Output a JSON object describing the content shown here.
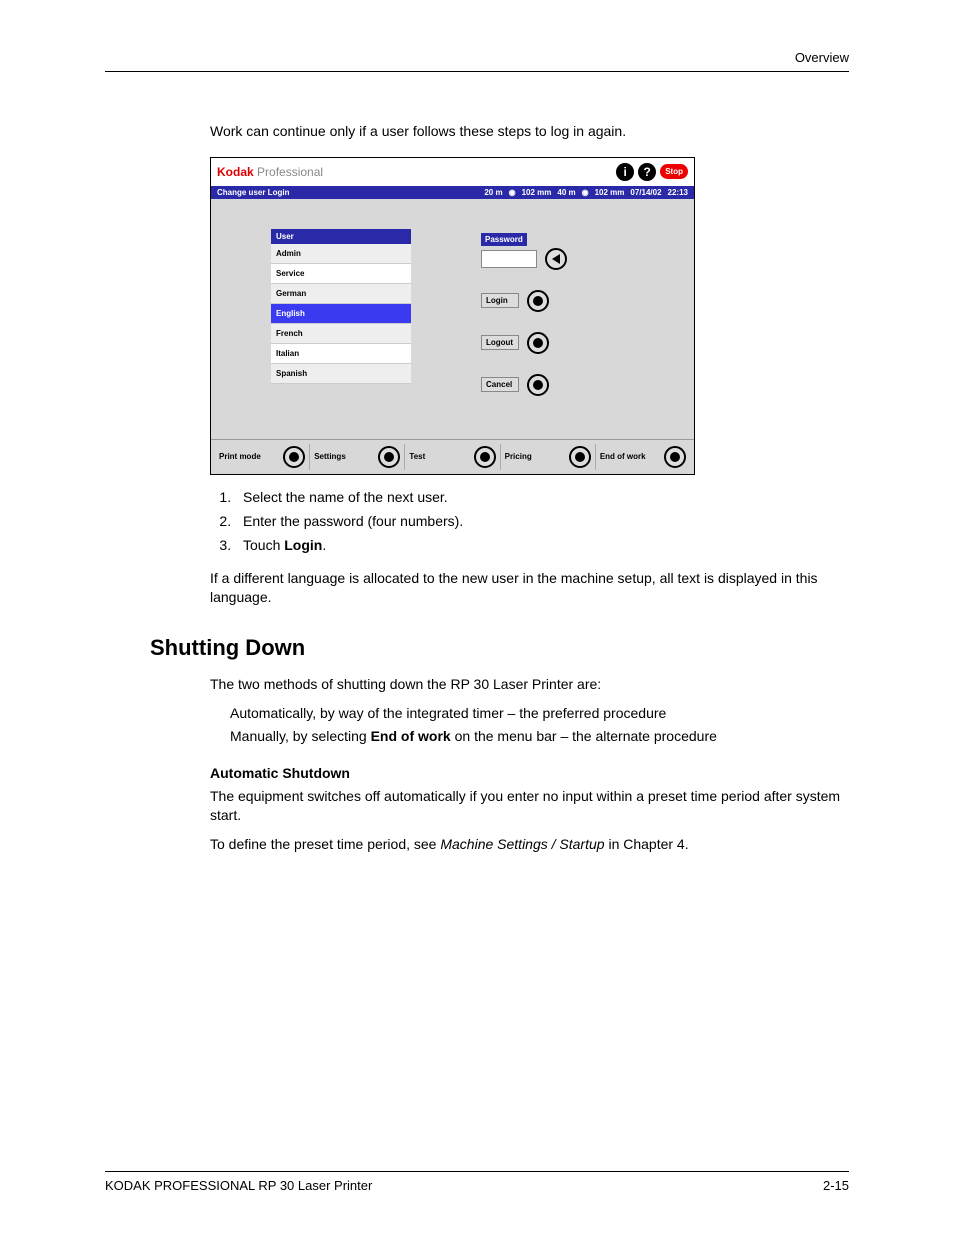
{
  "header": {
    "right": "Overview"
  },
  "intro": "Work can continue only if a user follows these steps to log in again.",
  "screenshot": {
    "brand_k": "Kodak",
    "brand_p": " Professional",
    "stop": "Stop",
    "bar_title": "Change user Login",
    "status_left": "20 m",
    "status_mid1": "102 mm",
    "status_mid2": "40 m",
    "status_mid3": "102 mm",
    "status_date": "07/14/02",
    "status_time": "22:13",
    "user_header": "User",
    "users": [
      "Admin",
      "Service",
      "German",
      "English",
      "French",
      "Italian",
      "Spanish"
    ],
    "selected_index": 3,
    "password_label": "Password",
    "btn_login": "Login",
    "btn_logout": "Logout",
    "btn_cancel": "Cancel",
    "tabs": [
      "Print mode",
      "Settings",
      "Test",
      "Pricing",
      "End of work"
    ]
  },
  "steps": [
    "Select the name of the next user.",
    "Enter the password (four numbers).",
    {
      "pre": "Touch ",
      "bold": "Login",
      "post": "."
    }
  ],
  "lang_note": "If a different language is allocated to the new user in the machine setup, all text is displayed in this language.",
  "section_title": "Shutting Down",
  "shut_intro": "The two methods of shutting down the RP 30 Laser Printer are:",
  "method1": "Automatically, by way of the integrated timer – the preferred procedure",
  "method2_pre": "Manually, by selecting ",
  "method2_bold": "End of work",
  "method2_post": " on the menu bar – the alternate procedure",
  "auto_header": "Automatic Shutdown",
  "auto_body": "The equipment switches off automatically if you enter no input within a preset time period after system start.",
  "auto_ref_pre": "To define the preset time period, see ",
  "auto_ref_it": "Machine Settings / Startup",
  "auto_ref_post": " in Chapter 4.",
  "footer": {
    "left": "KODAK PROFESSIONAL RP 30 Laser Printer",
    "right": "2-15"
  }
}
